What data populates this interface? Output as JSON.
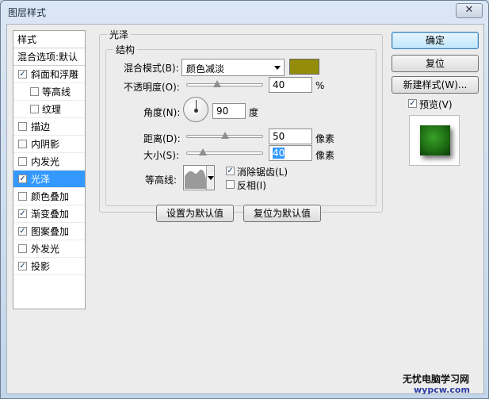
{
  "window": {
    "title": "图层样式",
    "close_glyph": "✕"
  },
  "styles_list": {
    "header": "样式",
    "blend_options": "混合选项:默认",
    "items": [
      {
        "label": "斜面和浮雕",
        "checked": true
      },
      {
        "label": "等高线",
        "checked": false
      },
      {
        "label": "纹理",
        "checked": false
      },
      {
        "label": "描边",
        "checked": false
      },
      {
        "label": "内阴影",
        "checked": false
      },
      {
        "label": "内发光",
        "checked": false
      },
      {
        "label": "光泽",
        "checked": true
      },
      {
        "label": "颜色叠加",
        "checked": false
      },
      {
        "label": "渐变叠加",
        "checked": true
      },
      {
        "label": "图案叠加",
        "checked": true
      },
      {
        "label": "外发光",
        "checked": false
      },
      {
        "label": "投影",
        "checked": true
      }
    ]
  },
  "satin": {
    "group_title": "光泽",
    "structure_title": "结构",
    "blend_mode_label": "混合模式(B):",
    "blend_mode_value": "颜色减淡",
    "color": "#948c0b",
    "opacity_label": "不透明度(O):",
    "opacity_value": "40",
    "opacity_unit": "%",
    "angle_label": "角度(N):",
    "angle_value": "90",
    "angle_unit": "度",
    "distance_label": "距离(D):",
    "distance_value": "50",
    "distance_unit": "像素",
    "size_label": "大小(S):",
    "size_value": "40",
    "size_unit": "像素",
    "contour_label": "等高线:",
    "antialias_label": "消除锯齿(L)",
    "antialias_checked": true,
    "invert_label": "反相(I)",
    "invert_checked": false,
    "make_default": "设置为默认值",
    "reset_default": "复位为默认值"
  },
  "right_panel": {
    "ok": "确定",
    "reset": "复位",
    "new_style": "新建样式(W)...",
    "preview_label": "预览(V)",
    "preview_checked": true
  },
  "watermark": {
    "line1": "无忧电脑学习网",
    "line2": "wypcw.com"
  },
  "check_glyph": "✓"
}
